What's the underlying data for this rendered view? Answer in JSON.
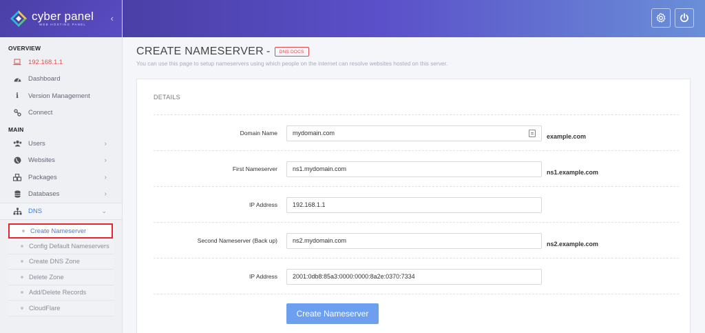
{
  "brand": {
    "name": "cyber panel",
    "tagline": "WEB HOSTING PANEL",
    "collapse_glyph": "‹"
  },
  "sidebar": {
    "overview_title": "OVERVIEW",
    "ip": "192.168.1.1",
    "overview_items": [
      {
        "label": "Dashboard",
        "icon": "dashboard-icon"
      },
      {
        "label": "Version Management",
        "icon": "info-icon"
      },
      {
        "label": "Connect",
        "icon": "link-icon"
      }
    ],
    "main_title": "MAIN",
    "main_items": [
      {
        "label": "Users",
        "icon": "users-icon"
      },
      {
        "label": "Websites",
        "icon": "globe-icon"
      },
      {
        "label": "Packages",
        "icon": "packages-icon"
      },
      {
        "label": "Databases",
        "icon": "database-icon"
      }
    ],
    "dns_label": "DNS",
    "dns_subitems": [
      "Create Nameserver",
      "Config Default Nameservers",
      "Create DNS Zone",
      "Delete Zone",
      "Add/Delete Records",
      "CloudFlare"
    ]
  },
  "header": {
    "settings_icon": "gear-icon",
    "power_icon": "power-icon"
  },
  "page": {
    "title": "CREATE NAMESERVER",
    "title_dash": "-",
    "docs_badge": "DNS DOCS",
    "description": "You can use this page to setup nameservers using which people on the internet can resolve websites hosted on this server."
  },
  "form": {
    "section_title": "DETAILS",
    "fields": [
      {
        "label": "Domain Name",
        "value": "mydomain.com",
        "hint": "example.com"
      },
      {
        "label": "First Nameserver",
        "value": "ns1.mydomain.com",
        "hint": "ns1.example.com"
      },
      {
        "label": "IP Address",
        "value": "192.168.1.1",
        "hint": ""
      },
      {
        "label": "Second Nameserver (Back up)",
        "value": "ns2.mydomain.com",
        "hint": "ns2.example.com"
      },
      {
        "label": "IP Address",
        "value": "2001:0db8:85a3:0000:0000:8a2e:0370:7334",
        "hint": ""
      }
    ],
    "submit_label": "Create Nameserver"
  },
  "colors": {
    "brand": "#4a3fa6",
    "accent": "#6c9ff0",
    "danger": "#e5252a"
  }
}
